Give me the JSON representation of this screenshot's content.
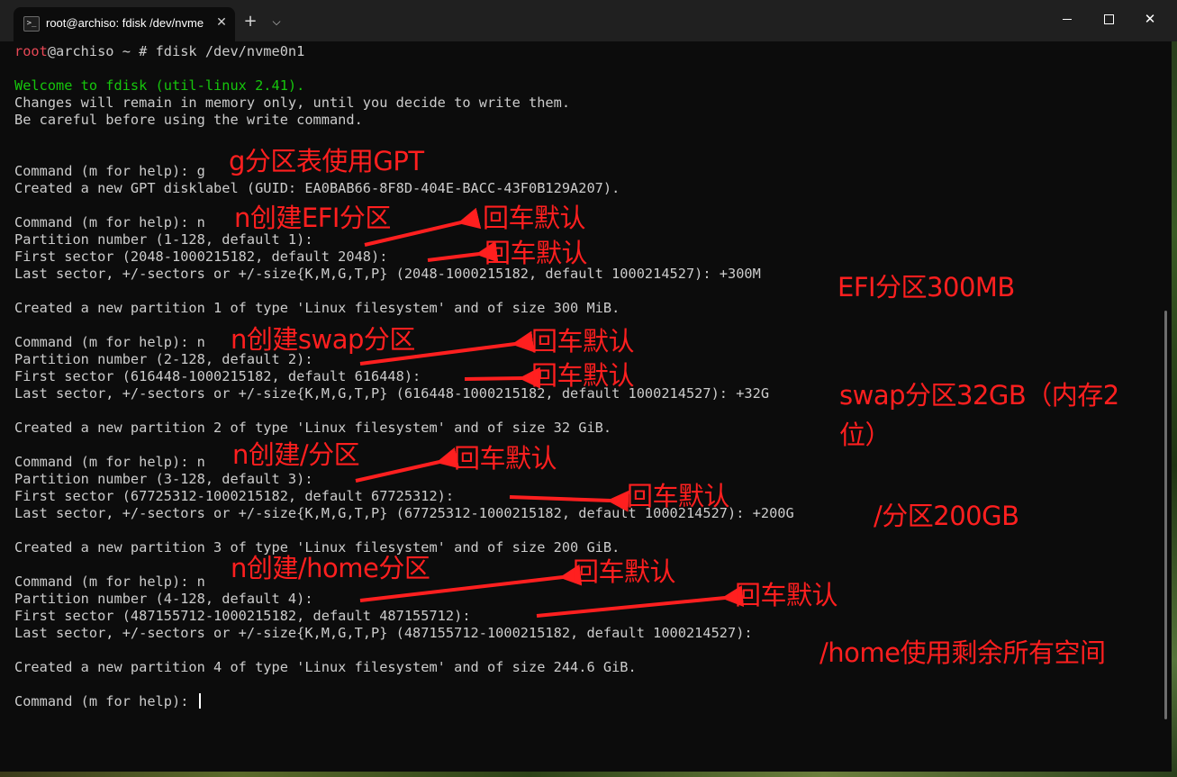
{
  "tab": {
    "title": "root@archiso: fdisk /dev/nvme",
    "close_glyph": "✕",
    "new_tab_glyph": "+",
    "dropdown_glyph": "⌵",
    "icon_name": "powershell-icon",
    "icon_glyph": ">_"
  },
  "window_controls": {
    "close_glyph": "✕"
  },
  "terminal": {
    "prompt_user": "root",
    "prompt_host": "@archiso ~ # ",
    "prompt_command": "fdisk /dev/nvme0n1",
    "welcome": "Welcome to fdisk (util-linux 2.41).",
    "notice_1": "Changes will remain in memory only, until you decide to write them.",
    "notice_2": "Be careful before using the write command.",
    "cmd_g": "Command (m for help): g",
    "gpt_created": "Created a new GPT disklabel (GUID: EA0BAB66-8F8D-404E-BACC-43F0B129A207).",
    "p1": {
      "cmd": "Command (m for help): n",
      "partition_number": "Partition number (1-128, default 1):",
      "first_sector": "First sector (2048-1000215182, default 2048):",
      "last_sector": "Last sector, +/-sectors or +/-size{K,M,G,T,P} (2048-1000215182, default 1000214527): +300M",
      "created": "Created a new partition 1 of type 'Linux filesystem' and of size 300 MiB."
    },
    "p2": {
      "cmd": "Command (m for help): n",
      "partition_number": "Partition number (2-128, default 2):",
      "first_sector": "First sector (616448-1000215182, default 616448):",
      "last_sector": "Last sector, +/-sectors or +/-size{K,M,G,T,P} (616448-1000215182, default 1000214527): +32G",
      "created": "Created a new partition 2 of type 'Linux filesystem' and of size 32 GiB."
    },
    "p3": {
      "cmd": "Command (m for help): n",
      "partition_number": "Partition number (3-128, default 3):",
      "first_sector": "First sector (67725312-1000215182, default 67725312):",
      "last_sector": "Last sector, +/-sectors or +/-size{K,M,G,T,P} (67725312-1000215182, default 1000214527): +200G",
      "created": "Created a new partition 3 of type 'Linux filesystem' and of size 200 GiB."
    },
    "p4": {
      "cmd": "Command (m for help): n",
      "partition_number": "Partition number (4-128, default 4):",
      "first_sector": "First sector (487155712-1000215182, default 487155712):",
      "last_sector": "Last sector, +/-sectors or +/-size{K,M,G,T,P} (487155712-1000215182, default 1000214527):",
      "created": "Created a new partition 4 of type 'Linux filesystem' and of size 244.6 GiB."
    },
    "final_prompt": "Command (m for help): "
  },
  "annotations": {
    "gpt": "g分区表使用GPT",
    "efi_create": "n创建EFI分区",
    "efi_enter_1": "回车默认",
    "efi_enter_2": "回车默认",
    "efi_size": "EFI分区300MB",
    "swap_create": "n创建swap分区",
    "swap_enter_1": "回车默认",
    "swap_enter_2": "回车默认",
    "swap_size_1": "swap分区32GB（内存2",
    "swap_size_2": "位）",
    "root_create": "n创建/分区",
    "root_enter_1": "回车默认",
    "root_enter_2": "回车默认",
    "root_size": "/分区200GB",
    "home_create": "n创建/home分区",
    "home_enter_1": "回车默认",
    "home_enter_2": "回车默认",
    "home_size": "/home使用剩余所有空间"
  },
  "colors": {
    "background": "#0c0c0c",
    "text": "#cccccc",
    "prompt_red": "#e74856",
    "welcome_green": "#16c60c",
    "annotation_red": "#ff1f1f"
  }
}
